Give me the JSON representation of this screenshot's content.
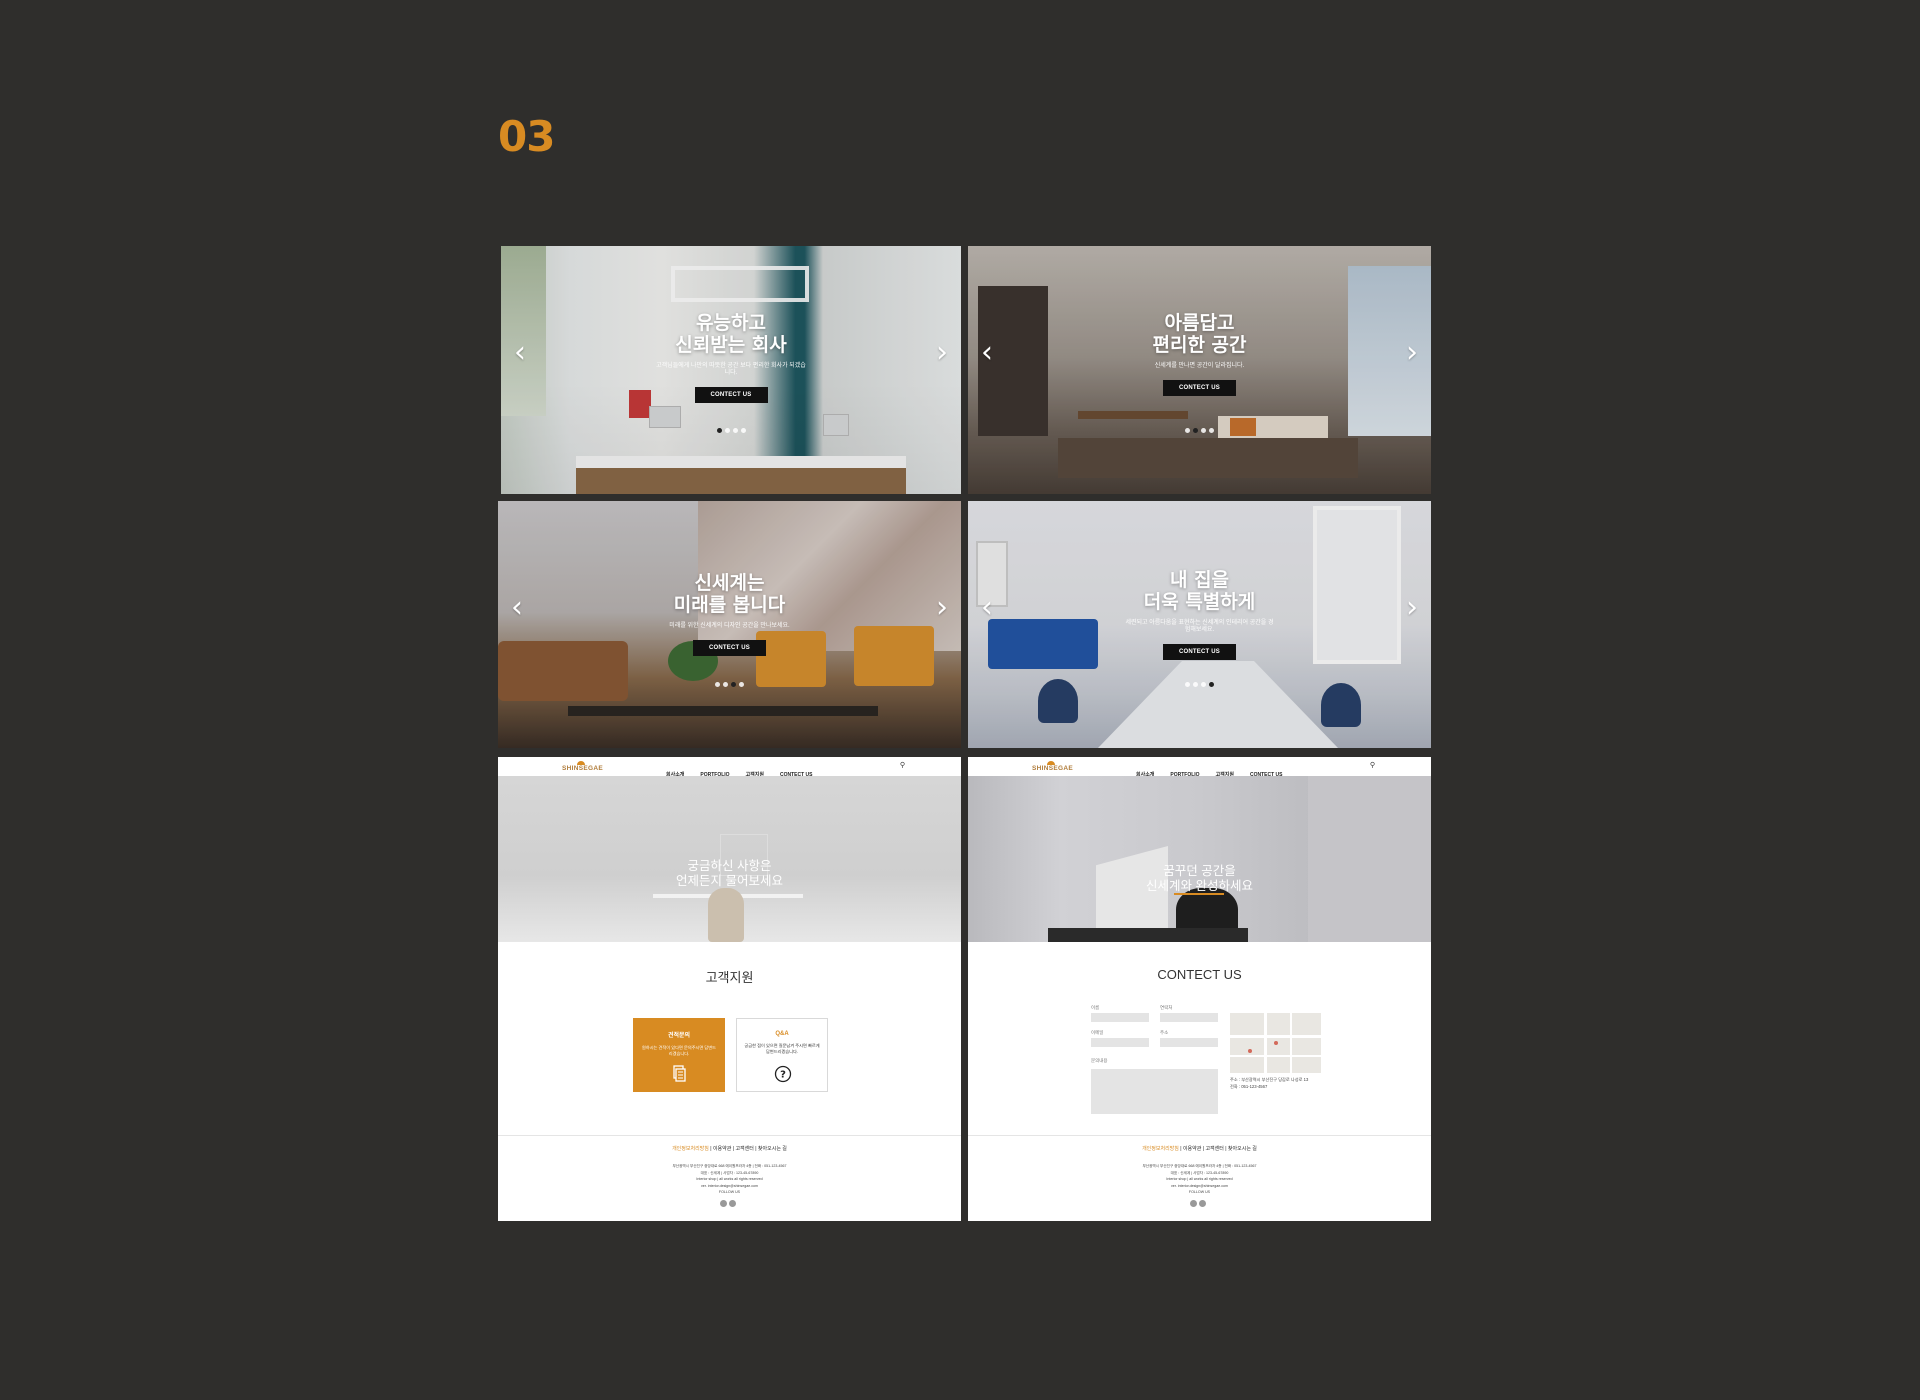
{
  "section": {
    "number": "03"
  },
  "colors": {
    "background": "#2f2e2c",
    "accent": "#d88b22"
  },
  "slides": [
    {
      "title_line1": "유능하고",
      "title_line2": "신뢰받는 회사",
      "subtitle": "고객님들에게 나만의 따뜻한 공간 보다 편리한 회사가 되겠습니다.",
      "button": "CONTECT US",
      "prev_icon": "chevron-left-icon",
      "next_icon": "chevron-right-icon",
      "slide_count": 4,
      "active_index": 0
    },
    {
      "title_line1": "아름답고",
      "title_line2": "편리한 공간",
      "subtitle": "신세계를 만나면 공간이 달라집니다.",
      "button": "CONTECT US",
      "prev_icon": "chevron-left-icon",
      "next_icon": "chevron-right-icon",
      "slide_count": 4,
      "active_index": 1
    },
    {
      "title_line1": "신세계는",
      "title_line2": "미래를 봅니다",
      "subtitle": "미래를 위한 신세계의 디자인 공간을 만나보세요.",
      "button": "CONTECT US",
      "prev_icon": "chevron-left-icon",
      "next_icon": "chevron-right-icon",
      "slide_count": 4,
      "active_index": 2
    },
    {
      "title_line1": "내 집을",
      "title_line2": "더욱 특별하게",
      "subtitle": "세련되고 아름다움을 표현하는 신세계의 인테리어 공간을 경험해보세요.",
      "button": "CONTECT US",
      "prev_icon": "chevron-left-icon",
      "next_icon": "chevron-right-icon",
      "slide_count": 4,
      "active_index": 3
    }
  ],
  "nav": {
    "logo": "SHINSEGAE",
    "items": [
      "회사소개",
      "PORTFOLIO",
      "고객지원",
      "CONTECT US"
    ],
    "search_icon": "search-icon"
  },
  "support_page": {
    "hero_line1": "궁금하신 사항은",
    "hero_line2": "언제든지 물어보세요",
    "section_title": "고객지원",
    "cards": [
      {
        "title": "견적문의",
        "desc": "원하시는 견적이 있다면 문의주시면 답변드리겠습니다.",
        "icon": "document-icon"
      },
      {
        "title": "Q&A",
        "desc": "궁금한 점이 있으면 질문남겨 주시면 빠르게 답변드리겠습니다.",
        "icon": "question-icon"
      }
    ]
  },
  "contact_page": {
    "hero_line1": "꿈꾸던 공간을",
    "hero_line2": "신세계와 완성하세요",
    "section_title": "CONTECT US",
    "fields": {
      "name": "이름",
      "phone": "연락처",
      "email": "이메일",
      "address": "주소",
      "message": "문의내용"
    },
    "map_address": "주소 : 부산광역시 부산진구 당감로 나성로 13",
    "map_phone": "전화 : 051-123-4567"
  },
  "footer": {
    "link_privacy": "개인정보처리방침",
    "link_terms": "이용약관",
    "link_support": "고객센터",
    "link_directions": "찾아오시는 길",
    "info1": "부산광역시 부산진구 중앙대로 668 에이원프라자 4층 | 전화 : 051-123-4567",
    "info2": "대표 : 신세계 | 사업자 : 123-45-67890",
    "info3": "Interior shop | all works all rights reserved",
    "info4": "ver. interior.design@shinsegae.com",
    "follow": "FOLLOW US"
  }
}
